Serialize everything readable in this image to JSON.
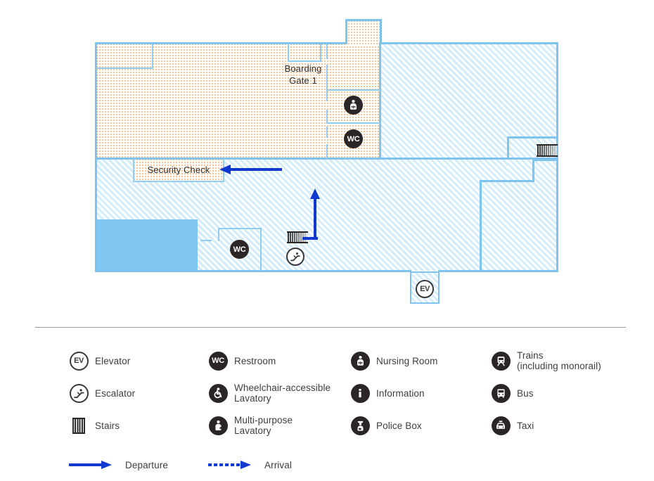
{
  "map": {
    "labels": [
      {
        "id": "boarding-gate-1",
        "text": "Boarding\nGate 1"
      },
      {
        "id": "security-check",
        "text": "Security Check"
      }
    ],
    "markers": [
      {
        "id": "nursing-room-marker",
        "icon": "nursing-room-icon"
      },
      {
        "id": "restroom-upper-marker",
        "icon": "restroom-icon",
        "text": "WC"
      },
      {
        "id": "restroom-lower-marker",
        "icon": "restroom-icon",
        "text": "WC"
      },
      {
        "id": "stairs-right-marker",
        "icon": "stairs-icon"
      },
      {
        "id": "stairs-center-marker",
        "icon": "stairs-icon"
      },
      {
        "id": "escalator-marker",
        "icon": "escalator-icon"
      },
      {
        "id": "elevator-marker",
        "icon": "elevator-icon",
        "text": "EV"
      }
    ],
    "flows": [
      {
        "id": "departure-flow-horizontal",
        "type": "departure"
      },
      {
        "id": "departure-flow-vertical",
        "type": "departure"
      }
    ],
    "colors": {
      "wall": "#7fc4ef",
      "restricted_fill": "#f3b479",
      "public_fill": "#e8f6fd",
      "solid_area": "#81c7f2",
      "departure_arrow": "#1039cf",
      "arrival_arrow": "#1039cf",
      "pictogram": "#2b2526"
    }
  },
  "legend": {
    "columns": [
      {
        "id": "legend-column-1",
        "items": [
          {
            "id": "elevator",
            "icon": "elevator-icon",
            "glyph": "EV",
            "label": "Elevator"
          },
          {
            "id": "escalator",
            "icon": "escalator-icon",
            "glyph": "",
            "label": "Escalator"
          },
          {
            "id": "stairs",
            "icon": "stairs-icon",
            "glyph": "",
            "label": "Stairs"
          }
        ],
        "flow": {
          "id": "departure",
          "icon": "departure-arrow-icon",
          "label": "Departure",
          "style": "solid"
        }
      },
      {
        "id": "legend-column-2",
        "items": [
          {
            "id": "restroom",
            "icon": "restroom-icon",
            "glyph": "WC",
            "label": "Restroom"
          },
          {
            "id": "wheelchair-accessible-lavatory",
            "icon": "wheelchair-icon",
            "glyph": "",
            "label": "Wheelchair-accessible\nLavatory"
          },
          {
            "id": "multi-purpose-lavatory",
            "icon": "multi-purpose-lavatory-icon",
            "glyph": "",
            "label": "Multi-purpose\nLavatory"
          }
        ],
        "flow": {
          "id": "arrival",
          "icon": "arrival-arrow-icon",
          "label": "Arrival",
          "style": "dotted"
        }
      },
      {
        "id": "legend-column-3",
        "items": [
          {
            "id": "nursing-room",
            "icon": "nursing-room-icon",
            "glyph": "",
            "label": "Nursing Room"
          },
          {
            "id": "information",
            "icon": "information-icon",
            "glyph": "",
            "label": "Information"
          },
          {
            "id": "police-box",
            "icon": "police-box-icon",
            "glyph": "",
            "label": "Police Box"
          }
        ],
        "flow": null
      },
      {
        "id": "legend-column-4",
        "items": [
          {
            "id": "trains",
            "icon": "train-icon",
            "glyph": "",
            "label": "Trains\n (including monorail)"
          },
          {
            "id": "bus",
            "icon": "bus-icon",
            "glyph": "",
            "label": "Bus"
          },
          {
            "id": "taxi",
            "icon": "taxi-icon",
            "glyph": "",
            "label": "Taxi"
          }
        ],
        "flow": null
      }
    ]
  }
}
